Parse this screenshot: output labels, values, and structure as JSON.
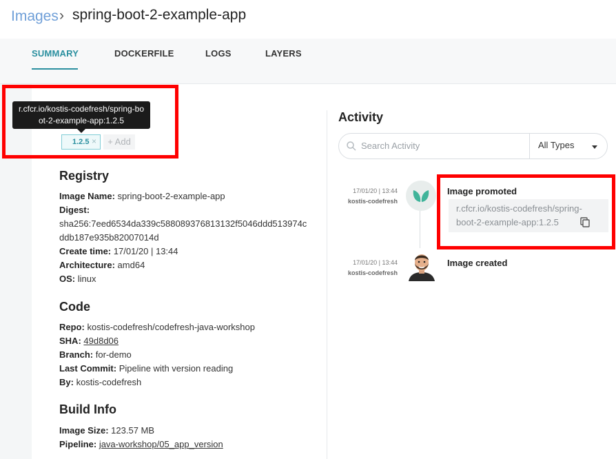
{
  "breadcrumb": {
    "root": "Images",
    "separator": "›",
    "title": "spring-boot-2-example-app"
  },
  "tabs": [
    {
      "label": "SUMMARY",
      "active": true
    },
    {
      "label": "DOCKERFILE",
      "active": false
    },
    {
      "label": "LOGS",
      "active": false
    },
    {
      "label": "LAYERS",
      "active": false
    }
  ],
  "tags": {
    "tooltip": "r.cfcr.io/kostis-codefresh/spring-boot-2-example-app:1.2.5",
    "tooltip_lines": [
      "r.cfcr.io/kostis-codefresh/spring-bo",
      "ot-2-example-app:1.2.5"
    ],
    "items": [
      {
        "label": "1.2.5",
        "remove": "×"
      }
    ],
    "add_label": "+ Add"
  },
  "registry": {
    "title": "Registry",
    "image_name_label": "Image Name:",
    "image_name": "spring-boot-2-example-app",
    "digest_label": "Digest:",
    "digest_lines": [
      "sha256:7eed6534da339c588089376813132f5046ddd513974c",
      "ddb187e935b82007014d"
    ],
    "create_time_label": "Create time:",
    "create_time": "17/01/20 | 13:44",
    "architecture_label": "Architecture:",
    "architecture": "amd64",
    "os_label": "OS:",
    "os": "linux"
  },
  "code": {
    "title": "Code",
    "repo_label": "Repo:",
    "repo": "kostis-codefresh/codefresh-java-workshop",
    "sha_label": "SHA:",
    "sha": "49d8d06",
    "branch_label": "Branch:",
    "branch": "for-demo",
    "last_commit_label": "Last Commit:",
    "last_commit": "Pipeline with version reading",
    "by_label": "By:",
    "by": "kostis-codefresh"
  },
  "build_info": {
    "title": "Build Info",
    "image_size_label": "Image Size:",
    "image_size": "123.57 MB",
    "pipeline_label": "Pipeline:",
    "pipeline": "java-workshop/05_app_version"
  },
  "activity": {
    "title": "Activity",
    "search_placeholder": "Search Activity",
    "type_filter": "All Types",
    "events": [
      {
        "time": "17/01/20 | 13:44",
        "user": "kostis-codefresh",
        "title": "Image promoted",
        "detail_lines": [
          "r.cfcr.io/kostis-codefresh/spring-",
          "boot-2-example-app:1.2.5"
        ],
        "icon": "leaf-icon"
      },
      {
        "time": "17/01/20 | 13:44",
        "user": "kostis-codefresh",
        "title": "Image created",
        "icon": "avatar"
      }
    ]
  },
  "colors": {
    "accent": "#2a8f9f",
    "link": "#6f9fd8",
    "highlight": "#ff0000",
    "tooltip_bg": "#1b1b1b"
  }
}
